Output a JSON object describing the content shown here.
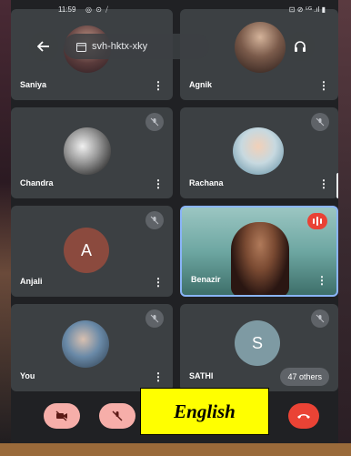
{
  "status_bar": {
    "time": "11:59",
    "left_icons": "◎ ⊙ ⧸",
    "right_icons": "⊡ ⊘ ⁵ᴳ .ıl ▮"
  },
  "top_bar": {
    "meeting_code": "svh-hktx-xky",
    "back_icon": "arrow-left-icon",
    "audio_icon": "headphones-icon"
  },
  "participants": [
    {
      "name": "Saniya",
      "avatar": "photo"
    },
    {
      "name": "Agnik",
      "avatar": "photo"
    },
    {
      "name": "Chandra",
      "avatar": "photo",
      "muted": true
    },
    {
      "name": "Rachana",
      "avatar": "photo",
      "muted": true
    },
    {
      "name": "Anjali",
      "avatar": "letter",
      "initial": "A",
      "color": "#8b4a3e",
      "muted": true
    },
    {
      "name": "Benazir",
      "avatar": "video",
      "speaking": true
    },
    {
      "name": "You",
      "avatar": "photo",
      "muted": true
    },
    {
      "name": "SATHI",
      "avatar": "letter",
      "initial": "S",
      "color": "#7e9aa3",
      "muted": true
    }
  ],
  "others_label": "47 others",
  "more_icon": "⋮",
  "controls": {
    "camera": "camera-off-icon",
    "mic": "mic-off-icon",
    "end_call": "end-call-icon"
  },
  "overlay_label": "English",
  "colors": {
    "tile": "#3c4043",
    "background": "#202124",
    "control_off": "#f6aea9",
    "end_call": "#ea4335",
    "overlay": "#ffff00"
  }
}
